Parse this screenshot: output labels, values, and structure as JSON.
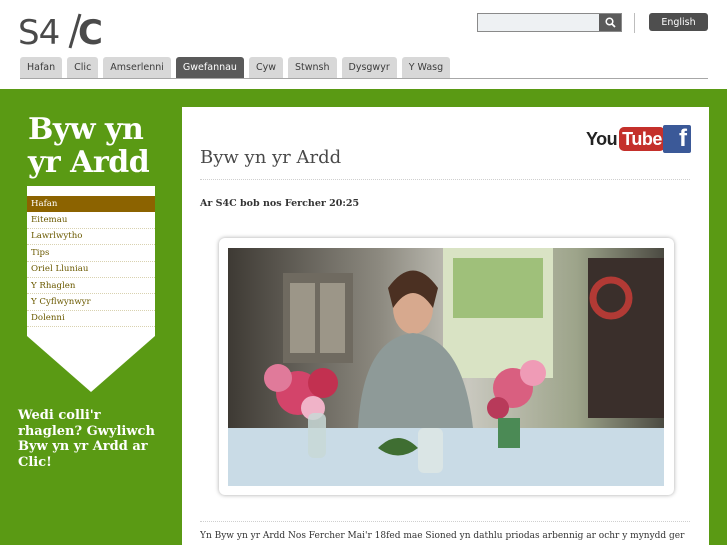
{
  "header": {
    "logo_text": "S4C",
    "search": {
      "placeholder": "",
      "value": ""
    },
    "language_button": "English"
  },
  "nav": {
    "tabs": [
      {
        "label": "Hafan",
        "active": false
      },
      {
        "label": "Clic",
        "active": false
      },
      {
        "label": "Amserlenni",
        "active": false
      },
      {
        "label": "Gwefannau",
        "active": true
      },
      {
        "label": "Cyw",
        "active": false
      },
      {
        "label": "Stwnsh",
        "active": false
      },
      {
        "label": "Dysgwyr",
        "active": false
      },
      {
        "label": "Y Wasg",
        "active": false
      }
    ]
  },
  "sidebar": {
    "programme_title": "Byw yn yr Ardd",
    "items": [
      {
        "label": "Hafan",
        "active": true
      },
      {
        "label": "Eitemau",
        "active": false
      },
      {
        "label": "Lawrlwytho",
        "active": false
      },
      {
        "label": "Tips",
        "active": false
      },
      {
        "label": "Oriel Lluniau",
        "active": false
      },
      {
        "label": "Y Rhaglen",
        "active": false
      },
      {
        "label": "Y Cyflwynwyr",
        "active": false
      },
      {
        "label": "Dolenni",
        "active": false
      }
    ],
    "missed_text": "Wedi colli'r rhaglen? Gwyliwch Byw yn yr Ardd ar Clic!"
  },
  "main": {
    "title": "Byw yn yr Ardd",
    "schedule": "Ar S4C bob nos Fercher 20:25",
    "body": "Yn Byw yn yr Ardd Nos Fercher Mai'r 18fed mae Sioned yn dathlu priodas arbennig ar ochr y mynydd ger",
    "social": {
      "youtube_you": "You",
      "youtube_tube": "Tube",
      "facebook": "f"
    }
  },
  "colors": {
    "green": "#5a9a14",
    "active_side": "#8c6300",
    "active_tab": "#5a5a5a"
  }
}
